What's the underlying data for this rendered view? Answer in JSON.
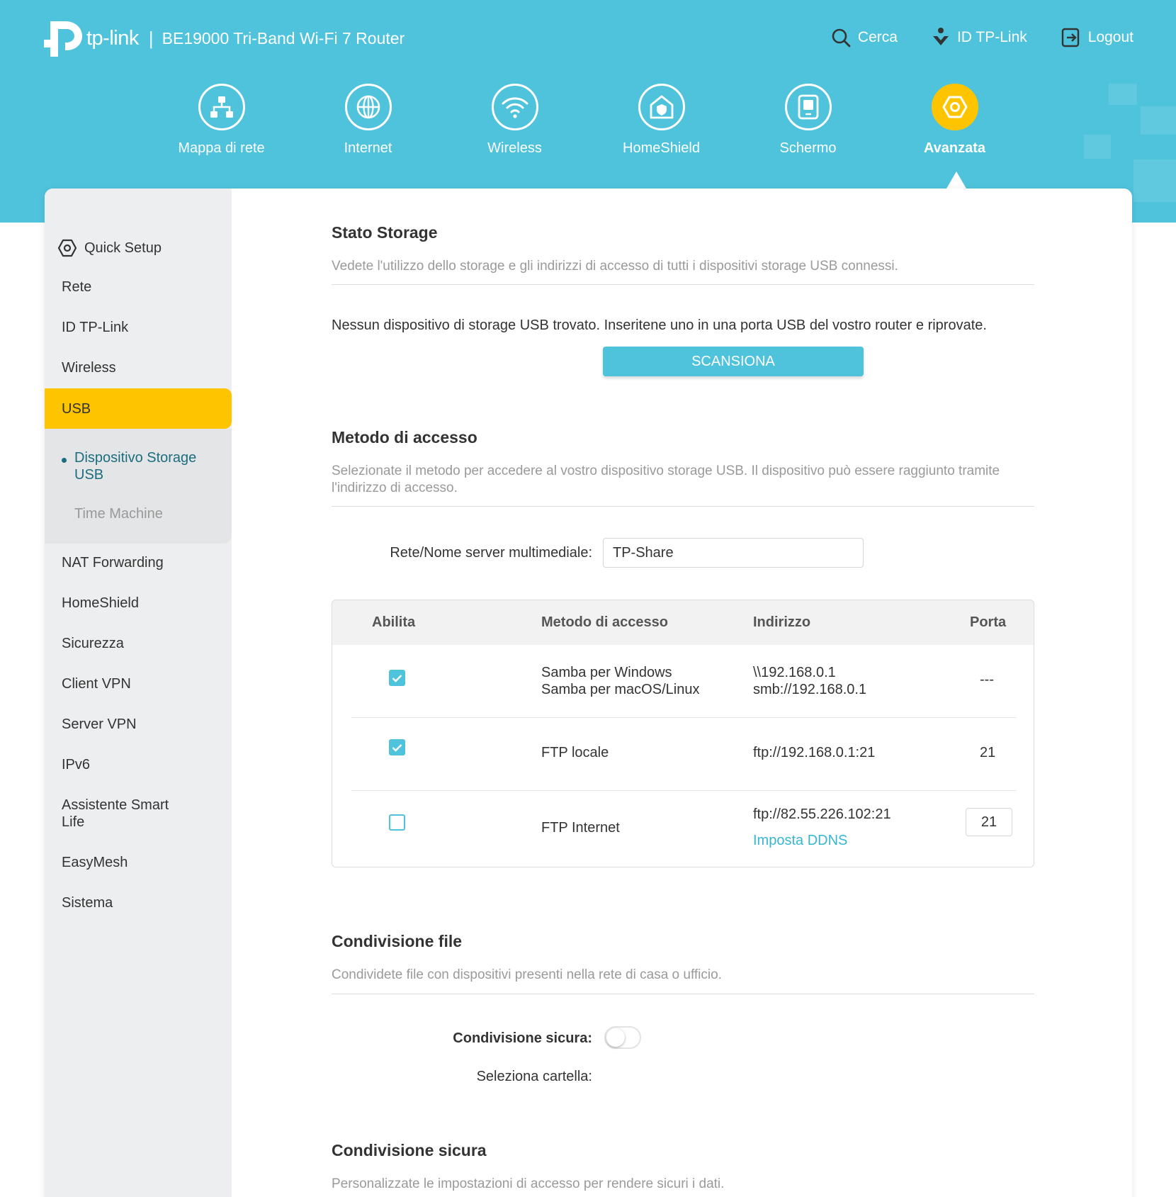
{
  "header": {
    "brand": "tp-link",
    "separator": "|",
    "model": "BE19000 Tri-Band Wi-Fi 7 Router",
    "links": {
      "search": "Cerca",
      "tplink_id": "ID TP-Link",
      "logout": "Logout"
    }
  },
  "nav": {
    "items": [
      {
        "label": "Mappa di rete",
        "icon": "network-map-icon"
      },
      {
        "label": "Internet",
        "icon": "globe-icon"
      },
      {
        "label": "Wireless",
        "icon": "wifi-icon"
      },
      {
        "label": "HomeShield",
        "icon": "home-shield-icon"
      },
      {
        "label": "Schermo",
        "icon": "screen-icon"
      },
      {
        "label": "Avanzata",
        "icon": "gear-icon",
        "active": true
      }
    ]
  },
  "sidebar": {
    "items": [
      {
        "label": "Quick Setup",
        "icon": "gear-icon"
      },
      {
        "label": "Rete"
      },
      {
        "label": "ID TP-Link"
      },
      {
        "label": "Wireless"
      },
      {
        "label": "USB",
        "active": true
      },
      {
        "label": "NAT Forwarding"
      },
      {
        "label": "HomeShield"
      },
      {
        "label": "Sicurezza"
      },
      {
        "label": "Client VPN"
      },
      {
        "label": "Server VPN"
      },
      {
        "label": "IPv6"
      },
      {
        "label": "Assistente Smart Life"
      },
      {
        "label": "EasyMesh"
      },
      {
        "label": "Sistema"
      }
    ],
    "usb_sub": [
      {
        "label": "Dispositivo Storage USB",
        "active": true
      },
      {
        "label": "Time Machine"
      }
    ]
  },
  "storage": {
    "title": "Stato Storage",
    "desc": "Vedete l'utilizzo dello storage e gli indirizzi di accesso di tutti i dispositivi storage USB connessi.",
    "message": "Nessun dispositivo di storage USB trovato. Inseritene uno in una porta USB del vostro router e riprovate.",
    "scan_button": "SCANSIONA"
  },
  "access": {
    "title": "Metodo di accesso",
    "desc": "Selezionate il metodo per accedere al vostro dispositivo storage USB. Il dispositivo può essere raggiunto tramite l'indirizzo di accesso.",
    "server_name_label": "Rete/Nome server multimediale:",
    "server_name_value": "TP-Share",
    "table": {
      "headers": {
        "enable": "Abilita",
        "method": "Metodo di accesso",
        "address": "Indirizzo",
        "port": "Porta"
      },
      "rows": [
        {
          "enabled": true,
          "method_1": "Samba per Windows",
          "method_2": "Samba per macOS/Linux",
          "address_1": "\\\\192.168.0.1",
          "address_2": "smb://192.168.0.1",
          "port": "---"
        },
        {
          "enabled": true,
          "method": "FTP locale",
          "address": "ftp://192.168.0.1:21",
          "port": "21"
        },
        {
          "enabled": false,
          "method": "FTP Internet",
          "address": "ftp://82.55.226.102:21",
          "link": "Imposta DDNS",
          "port": "21"
        }
      ]
    }
  },
  "sharing": {
    "title": "Condivisione file",
    "desc": "Condividete file con dispositivi presenti nella rete di casa o ufficio.",
    "secure_label": "Condivisione sicura:",
    "secure_on": false,
    "folder_label": "Seleziona cartella:"
  },
  "secure": {
    "title": "Condivisione sicura",
    "desc": "Personalizzate le impostazioni di accesso per rendere sicuri i dati."
  },
  "colors": {
    "header_bg": "#4fc3dc",
    "accent_yellow": "#ffc400",
    "active_sub_text": "#1c6d7f",
    "link": "#37b6d3"
  }
}
